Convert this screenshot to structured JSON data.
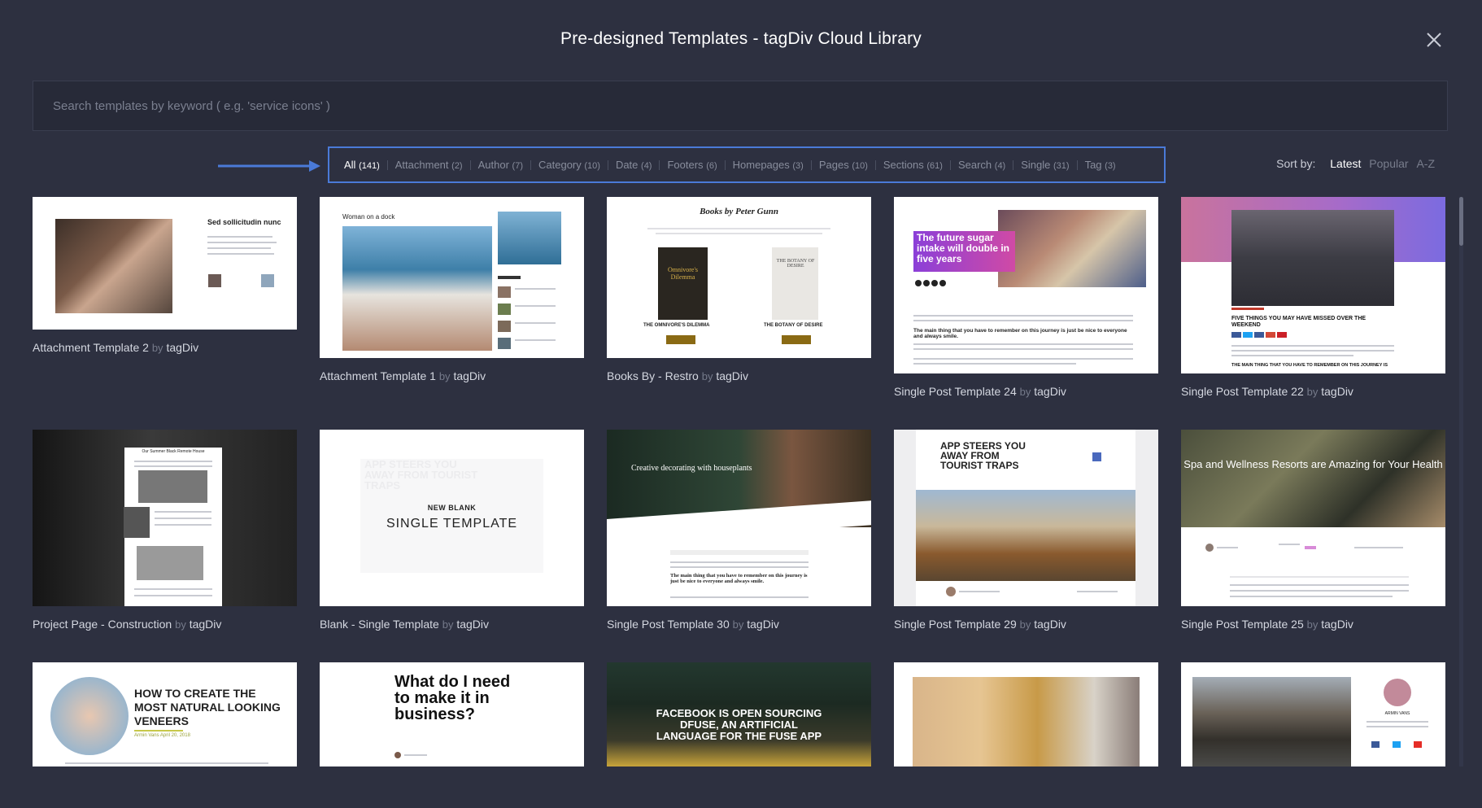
{
  "header": {
    "title": "Pre-designed Templates - tagDiv Cloud Library",
    "close_icon": "close-icon"
  },
  "search": {
    "placeholder": "Search templates by keyword ( e.g. 'service icons' )",
    "value": ""
  },
  "filters": [
    {
      "label": "All",
      "count": "(141)",
      "active": true
    },
    {
      "label": "Attachment",
      "count": "(2)",
      "active": false
    },
    {
      "label": "Author",
      "count": "(7)",
      "active": false
    },
    {
      "label": "Category",
      "count": "(10)",
      "active": false
    },
    {
      "label": "Date",
      "count": "(4)",
      "active": false
    },
    {
      "label": "Footers",
      "count": "(6)",
      "active": false
    },
    {
      "label": "Homepages",
      "count": "(3)",
      "active": false
    },
    {
      "label": "Pages",
      "count": "(10)",
      "active": false
    },
    {
      "label": "Sections",
      "count": "(61)",
      "active": false
    },
    {
      "label": "Search",
      "count": "(4)",
      "active": false
    },
    {
      "label": "Single",
      "count": "(31)",
      "active": false
    },
    {
      "label": "Tag",
      "count": "(3)",
      "active": false
    }
  ],
  "sort": {
    "label": "Sort by:",
    "options": [
      {
        "label": "Latest",
        "active": true
      },
      {
        "label": "Popular",
        "active": false
      },
      {
        "label": "A-Z",
        "active": false
      }
    ]
  },
  "colors": {
    "background": "#2d3040",
    "highlight_border": "#4a7ad8",
    "arrow": "#4a7ad8"
  },
  "templates": [
    {
      "name": "Attachment Template 2",
      "by": "by",
      "author": "tagDiv",
      "thumb_text": [
        "Sed sollicitudin nunc"
      ]
    },
    {
      "name": "Attachment Template 1",
      "by": "by",
      "author": "tagDiv",
      "thumb_text": [
        "Woman on a dock"
      ]
    },
    {
      "name": "Books By - Restro",
      "by": "by",
      "author": "tagDiv",
      "thumb_text": [
        "Books by Peter Gunn",
        "Omnivore's Dilemma",
        "THE BOTANY OF DESIRE",
        "THE OMNIVORE'S DILEMMA",
        "THE BOTANY OF DESIRE"
      ]
    },
    {
      "name": "Single Post Template 24",
      "by": "by",
      "author": "tagDiv",
      "thumb_text": [
        "The future sugar intake will double in five years",
        "The main thing that you have to remember on this journey is just be nice to everyone and always smile."
      ]
    },
    {
      "name": "Single Post Template 22",
      "by": "by",
      "author": "tagDiv",
      "thumb_text": [
        "FIVE THINGS YOU MAY HAVE MISSED OVER THE WEEKEND",
        "THE MAIN THING THAT YOU HAVE TO REMEMBER ON THIS JOURNEY IS"
      ]
    },
    {
      "name": "Project Page - Construction",
      "by": "by",
      "author": "tagDiv",
      "thumb_text": [
        "Our Summer Black Remote House"
      ]
    },
    {
      "name": "Blank - Single Template",
      "by": "by",
      "author": "tagDiv",
      "thumb_text": [
        "NEW BLANK",
        "SINGLE TEMPLATE",
        "APP STEERS YOU AWAY FROM TOURIST TRAPS"
      ]
    },
    {
      "name": "Single Post Template 30",
      "by": "by",
      "author": "tagDiv",
      "thumb_text": [
        "Creative decorating with houseplants",
        "The main thing that you have to remember on this journey is just be nice to everyone and always smile."
      ]
    },
    {
      "name": "Single Post Template 29",
      "by": "by",
      "author": "tagDiv",
      "thumb_text": [
        "APP STEERS YOU AWAY FROM TOURIST TRAPS"
      ]
    },
    {
      "name": "Single Post Template 25",
      "by": "by",
      "author": "tagDiv",
      "thumb_text": [
        "Spa and Wellness Resorts are Amazing for Your Health"
      ]
    },
    {
      "name": "",
      "by": "",
      "author": "",
      "thumb_text": [
        "HOW TO CREATE THE MOST NATURAL LOOKING VENEERS",
        "Armin Vans",
        "April 20, 2018"
      ]
    },
    {
      "name": "",
      "by": "",
      "author": "",
      "thumb_text": [
        "What do I need to make it in business?"
      ]
    },
    {
      "name": "",
      "by": "",
      "author": "",
      "thumb_text": [
        "FACEBOOK IS OPEN SOURCING DFUSE, AN ARTIFICIAL LANGUAGE FOR THE FUSE APP"
      ]
    },
    {
      "name": "",
      "by": "",
      "author": "",
      "thumb_text": []
    },
    {
      "name": "",
      "by": "",
      "author": "",
      "thumb_text": [
        "ARMIN VANS"
      ]
    }
  ]
}
